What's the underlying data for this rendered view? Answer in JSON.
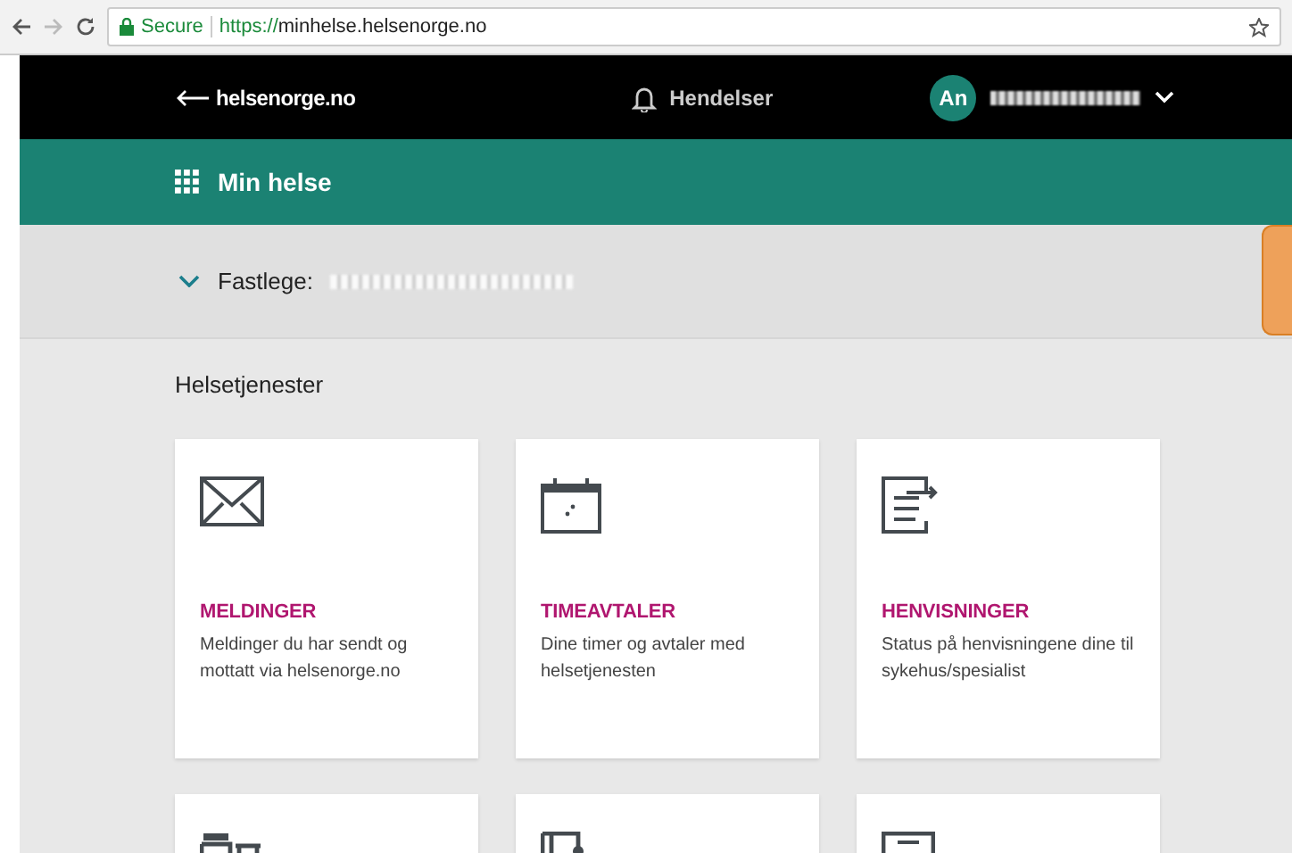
{
  "browser": {
    "secure_label": "Secure",
    "url_scheme": "https://",
    "url_host": "minhelse.helsenorge.no"
  },
  "header": {
    "back_link": "helsenorge.no",
    "notifications": "Hendelser",
    "avatar_initials": "An"
  },
  "subheader": {
    "title": "Min helse"
  },
  "fastlege": {
    "label": "Fastlege:",
    "expanded": false
  },
  "section_title": "Helsetjenester",
  "cards": [
    {
      "kind": "envelope",
      "title": "MELDINGER",
      "description": "Meldinger du har sendt og mottatt via helsenorge.no"
    },
    {
      "kind": "calendar",
      "title": "TIMEAVTALER",
      "description": "Dine timer og avtaler med helsetjenesten"
    },
    {
      "kind": "referral",
      "title": "HENVISNINGER",
      "description": "Status på henvisningene dine til sykehus/spesialist"
    },
    {
      "kind": "medicine"
    },
    {
      "kind": "record"
    },
    {
      "kind": "form"
    }
  ]
}
